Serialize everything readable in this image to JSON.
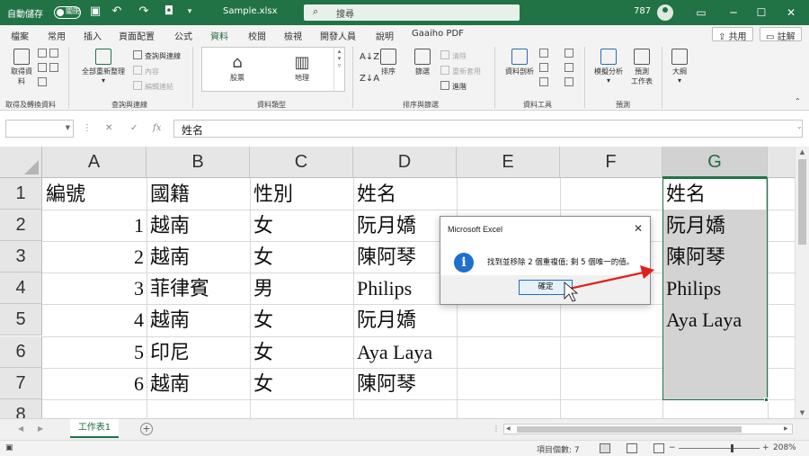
{
  "titlebar": {
    "autosave_label": "自動儲存",
    "autosave_state": "關閉",
    "filename": "Sample.xlsx",
    "search_placeholder": "搜尋",
    "user": "787"
  },
  "tabs": [
    "檔案",
    "常用",
    "插入",
    "頁面配置",
    "公式",
    "資料",
    "校閱",
    "檢視",
    "開發人員",
    "說明",
    "Gaaiho PDF"
  ],
  "active_tab": "資料",
  "tab_actions": {
    "share": "共用",
    "comment": "註解"
  },
  "ribbon": {
    "get_data": {
      "btn_line1": "取得資",
      "btn_line2": "料",
      "label": "取得及轉換資料"
    },
    "query": {
      "refresh_line1": "全部重新整理",
      "queries": "查詢與連線",
      "properties": "內容",
      "edit_links": "編輯連結",
      "label": "查詢與連線"
    },
    "data_types": {
      "stocks": "股票",
      "geography": "地理",
      "label": "資料類型"
    },
    "sort_filter": {
      "sort": "排序",
      "filter": "篩選",
      "clear": "清除",
      "reapply": "重新套用",
      "advanced": "進階",
      "label": "排序與篩選"
    },
    "data_tools": {
      "text_to_columns": "資料剖析",
      "label": "資料工具"
    },
    "forecast": {
      "what_if": "模擬分析",
      "forecast_line1": "預測",
      "forecast_line2": "工作表",
      "label": "預測"
    },
    "outline": {
      "outline": "大綱"
    }
  },
  "formula_bar": {
    "name_box": "",
    "formula": "姓名"
  },
  "columns": [
    "A",
    "B",
    "C",
    "D",
    "E",
    "F",
    "G"
  ],
  "rows": [
    "1",
    "2",
    "3",
    "4",
    "5",
    "6",
    "7",
    "8"
  ],
  "cells": {
    "r1": [
      "編號",
      "國籍",
      "性別",
      "姓名",
      "",
      "",
      "姓名"
    ],
    "r2": [
      "1",
      "越南",
      "女",
      "阮月嬌",
      "",
      "",
      "阮月嬌"
    ],
    "r3": [
      "2",
      "越南",
      "女",
      "陳阿琴",
      "",
      "",
      "陳阿琴"
    ],
    "r4": [
      "3",
      "菲律賓",
      "男",
      "Philips",
      "",
      "",
      "Philips"
    ],
    "r5": [
      "4",
      "越南",
      "女",
      "阮月嬌",
      "",
      "",
      "Aya Laya"
    ],
    "r6": [
      "5",
      "印尼",
      "女",
      "Aya Laya",
      "",
      "",
      ""
    ],
    "r7": [
      "6",
      "越南",
      "女",
      "陳阿琴",
      "",
      "",
      ""
    ]
  },
  "sheet_tab": "工作表1",
  "status": {
    "count": "項目個數: 7",
    "zoom": "208%"
  },
  "dialog": {
    "title": "Microsoft Excel",
    "message": "找到並移除 2 個重複值; 剩 5 個唯一的值。",
    "ok": "確定"
  },
  "colors": {
    "excel_green": "#217346",
    "info_blue": "#1e6fcf",
    "arrow_red": "#e0201c",
    "selection_gray": "#d3d3d3"
  },
  "icons": [
    "autosave-toggle",
    "save-icon",
    "undo-icon",
    "redo-icon",
    "camera-icon",
    "search-icon",
    "avatar-icon",
    "info-icon",
    "close-icon",
    "add-sheet-icon"
  ]
}
